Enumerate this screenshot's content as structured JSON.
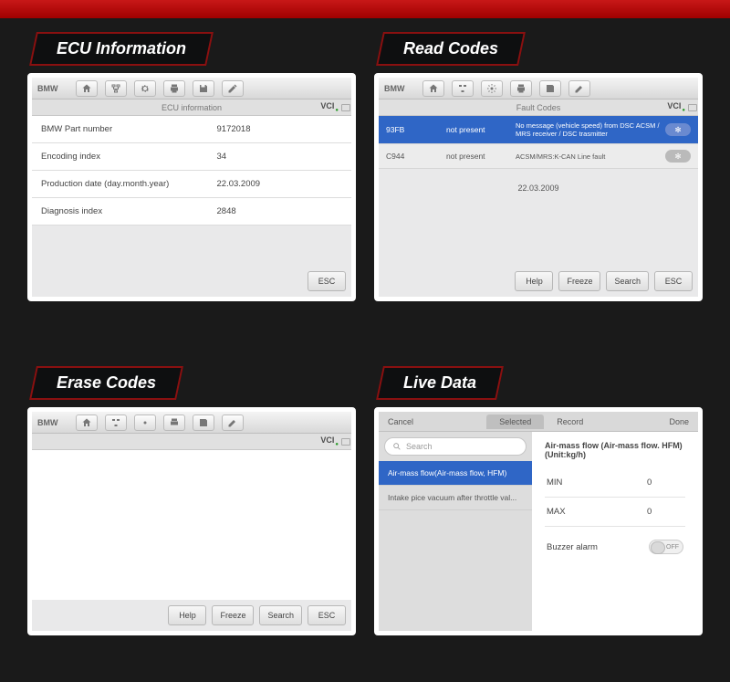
{
  "labels": {
    "ecu": "ECU Information",
    "read": "Read Codes",
    "erase": "Erase Codes",
    "live": "Live Data"
  },
  "toolbar_brand": "BMW",
  "vci_label": "VCI",
  "ecu": {
    "subheader": "ECU information",
    "rows": [
      {
        "k": "BMW Part number",
        "v": "9172018"
      },
      {
        "k": "Encoding index",
        "v": "34"
      },
      {
        "k": "Production date (day.month.year)",
        "v": "22.03.2009"
      },
      {
        "k": "Diagnosis index",
        "v": "2848"
      }
    ],
    "esc": "ESC"
  },
  "read": {
    "subheader": "Fault Codes",
    "faults": [
      {
        "code": "93FB",
        "status": "not present",
        "desc": "No message (vehicle speed) from DSC ACSM / MRS receiver / DSC trasmitter",
        "selected": true
      },
      {
        "code": "C944",
        "status": "not present",
        "desc": "ACSM/MRS:K-CAN Line fault",
        "selected": false
      }
    ],
    "date": "22.03.2009",
    "buttons": {
      "help": "Help",
      "freeze": "Freeze",
      "search": "Search",
      "esc": "ESC"
    }
  },
  "erase": {
    "buttons": {
      "help": "Help",
      "freeze": "Freeze",
      "search": "Search",
      "esc": "ESC"
    }
  },
  "live": {
    "top": {
      "cancel": "Cancel",
      "selected": "Selected",
      "record": "Record",
      "done": "Done"
    },
    "search_placeholder": "Search",
    "params": [
      {
        "label": "Air-mass flow(Air-mass flow, HFM)",
        "active": true
      },
      {
        "label": "Intake pice vacuum after throttle val...",
        "active": false
      }
    ],
    "detail": {
      "title": "Air-mass flow (Air-mass flow. HFM)(Unit:kg/h)",
      "min_label": "MIN",
      "min_value": "0",
      "max_label": "MAX",
      "max_value": "0",
      "buzzer_label": "Buzzer alarm",
      "toggle_label": "OFF"
    }
  }
}
